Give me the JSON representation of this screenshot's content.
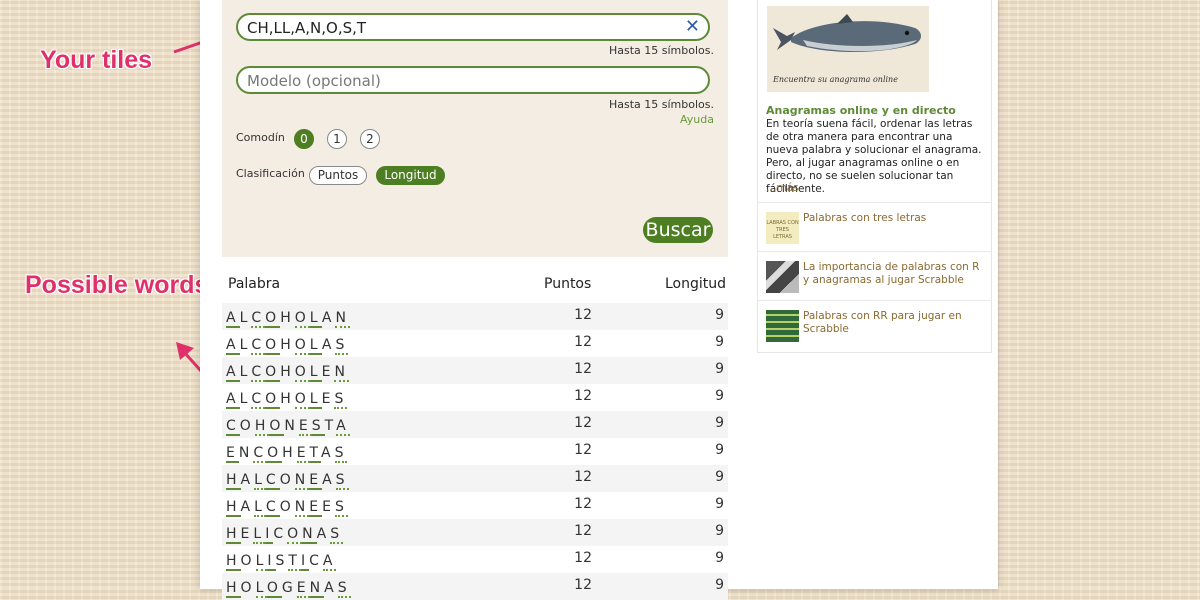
{
  "annotations": {
    "tiles_label": "Your tiles",
    "words_label": "Possible words"
  },
  "form": {
    "tiles_value": "CH,LL,A,N,O,S,T",
    "tiles_hint": "Hasta 15 símbolos.",
    "pattern_placeholder": "Modelo (opcional)",
    "pattern_hint": "Hasta 15 símbolos.",
    "help_link": "Ayuda",
    "wildcard_label": "Comodín",
    "wildcard_options": [
      "0",
      "1",
      "2"
    ],
    "wildcard_selected": "0",
    "sort_label": "Clasificación",
    "sort_options": [
      "Puntos",
      "Longitud"
    ],
    "sort_selected": "Longitud",
    "search_button": "Buscar",
    "clear_icon": "close-x-icon"
  },
  "results": {
    "headers": [
      "Palabra",
      "Puntos",
      "Longitud"
    ],
    "rows": [
      {
        "word": "ALCOHOLAN",
        "points": "12",
        "length": "9"
      },
      {
        "word": "ALCOHOLAS",
        "points": "12",
        "length": "9"
      },
      {
        "word": "ALCOHOLEN",
        "points": "12",
        "length": "9"
      },
      {
        "word": "ALCOHOLES",
        "points": "12",
        "length": "9"
      },
      {
        "word": "COHONESTA",
        "points": "12",
        "length": "9"
      },
      {
        "word": "ENCOHETAS",
        "points": "12",
        "length": "9"
      },
      {
        "word": "HALCONEAS",
        "points": "12",
        "length": "9"
      },
      {
        "word": "HALCONEES",
        "points": "12",
        "length": "9"
      },
      {
        "word": "HELICONAS",
        "points": "12",
        "length": "9"
      },
      {
        "word": "HOLISTICA",
        "points": "12",
        "length": "9"
      },
      {
        "word": "HOLOGENAS",
        "points": "12",
        "length": "9"
      }
    ]
  },
  "sidebar": {
    "image_caption": "Encuentra su anagrama online",
    "title": "Anagramas online y en directo",
    "text": "En teoría suena fácil, ordenar las letras de otra manera para encontrar una nueva palabra y solucionar el anagrama. Pero, al jugar anagramas online o en directo, no se suelen solucionar tan fácilmente.",
    "more": "…más",
    "items": [
      {
        "label": "Palabras con tres letras",
        "thumb_text": "LABRAS CON TRES LETRAS"
      },
      {
        "label": "La importancia de palabras con R y anagramas al jugar Scrabble"
      },
      {
        "label": "Palabras con RR para jugar en Scrabble"
      }
    ]
  }
}
